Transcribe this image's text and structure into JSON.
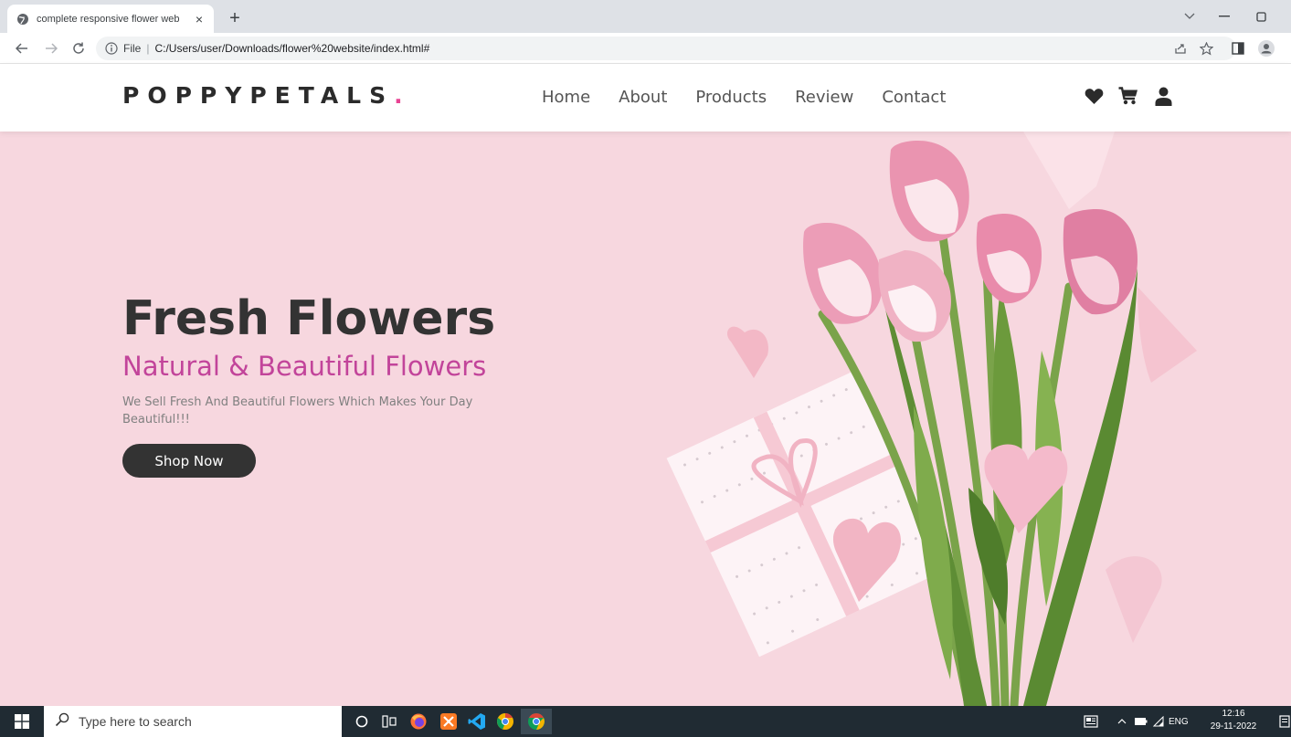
{
  "browser": {
    "tab_title": "complete responsive flower web",
    "tab_close": "×",
    "new_tab": "+",
    "address_scheme": "File",
    "address_sep": "|",
    "address_url": "C:/Users/user/Downloads/flower%20website/index.html#"
  },
  "site": {
    "logo_text": "POPPYPETALS",
    "logo_dot": ".",
    "nav": [
      "Home",
      "About",
      "Products",
      "Review",
      "Contact"
    ],
    "accent_color": "#e84393",
    "icons": [
      "heart-icon",
      "cart-icon",
      "user-icon"
    ]
  },
  "hero": {
    "title": "Fresh Flowers",
    "subtitle": "Natural & Beautiful Flowers",
    "description": "We Sell Fresh And Beautiful Flowers Which Makes Your Day Beautiful!!!",
    "button_label": "Shop Now",
    "background_color": "#f7d7df"
  },
  "taskbar": {
    "search_placeholder": "Type here to search",
    "language": "ENG",
    "time": "12:16",
    "date": "29-11-2022"
  }
}
